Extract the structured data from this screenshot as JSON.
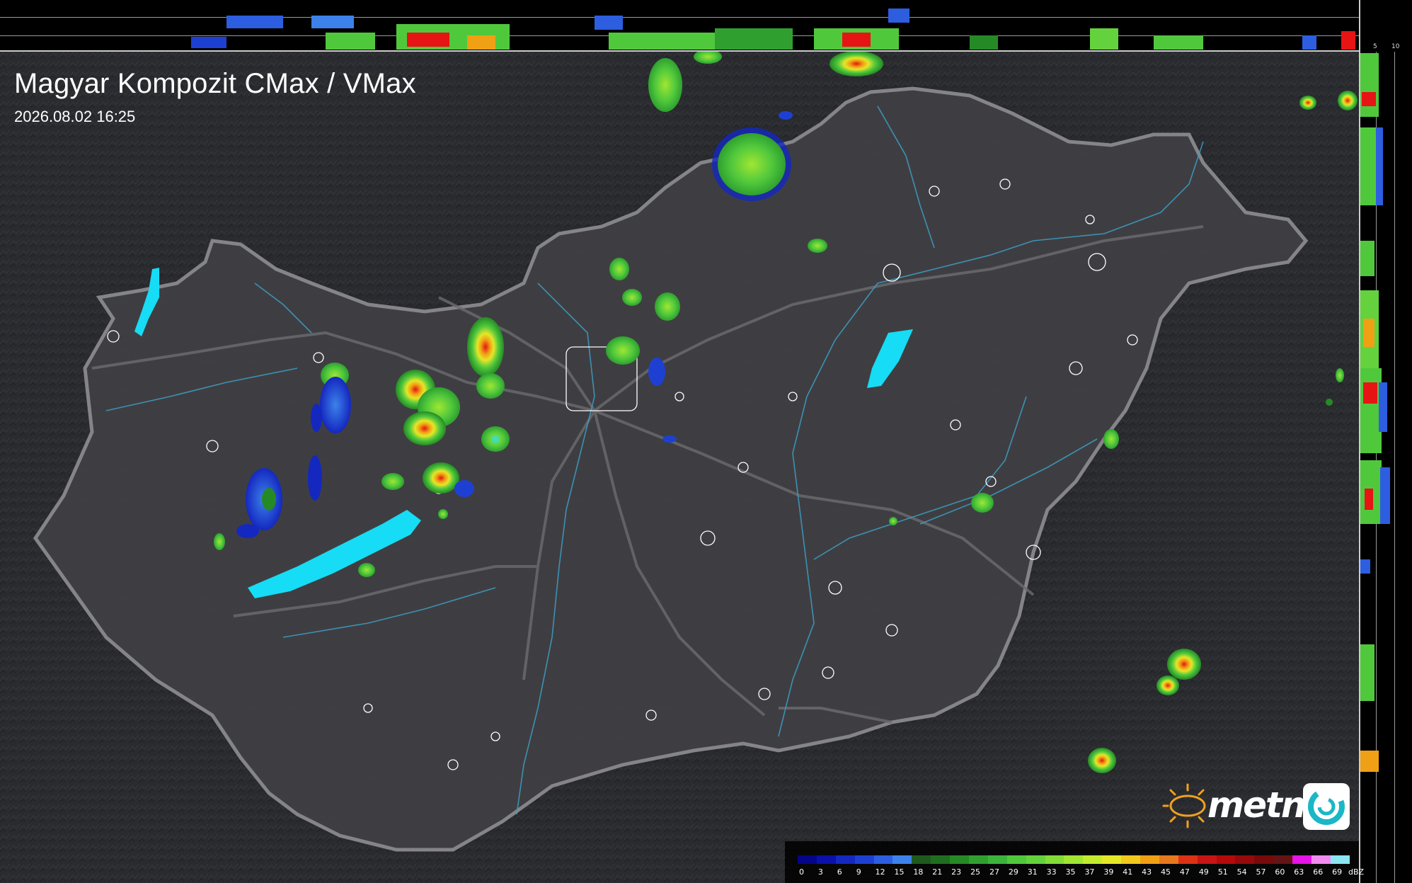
{
  "header": {
    "title": "Magyar Kompozit CMax / VMax",
    "timestamp": "2026.08.02 16:25"
  },
  "brand": {
    "logo_text": "metnet",
    "sun_icon": "sun-icon",
    "badge_icon": "swirl-icon"
  },
  "profile_axes": {
    "top_ticks": [
      "10",
      "5"
    ],
    "right_ticks": [
      "5",
      "10"
    ]
  },
  "legend": {
    "unit": "dBZ",
    "values": [
      "0",
      "3",
      "6",
      "9",
      "12",
      "15",
      "18",
      "21",
      "23",
      "25",
      "27",
      "29",
      "31",
      "33",
      "35",
      "37",
      "39",
      "41",
      "43",
      "45",
      "47",
      "49",
      "51",
      "54",
      "57",
      "60",
      "63",
      "66",
      "69"
    ],
    "colors": [
      "#05058a",
      "#0a10a8",
      "#1428c0",
      "#1e40d2",
      "#2d5ee0",
      "#3c82ea",
      "#1e5a1e",
      "#1f6e1f",
      "#258a25",
      "#2fa02f",
      "#3cb43c",
      "#50c83c",
      "#64d23c",
      "#82dc37",
      "#a0e632",
      "#c3eb2d",
      "#e6e628",
      "#f0c81e",
      "#f0a014",
      "#e6781e",
      "#dc3214",
      "#c81414",
      "#b40a0a",
      "#960a0a",
      "#780a0a",
      "#641414",
      "#e614e6",
      "#f08cf0",
      "#8ce6f0"
    ]
  }
}
